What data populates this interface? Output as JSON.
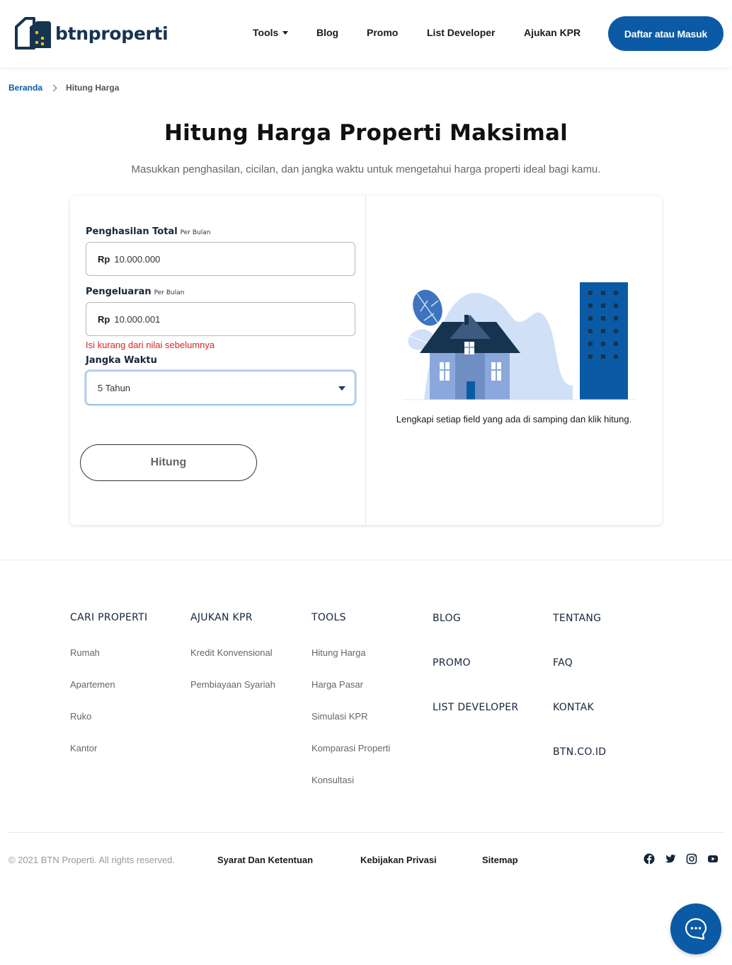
{
  "header": {
    "logo_text": "btnproperti",
    "nav": {
      "tools": "Tools",
      "blog": "Blog",
      "promo": "Promo",
      "list_developer": "List Developer",
      "ajukan_kpr": "Ajukan KPR"
    },
    "login_button": "Daftar atau Masuk"
  },
  "breadcrumb": {
    "home": "Beranda",
    "current": "Hitung Harga"
  },
  "page": {
    "title": "Hitung Harga Properti Maksimal",
    "subtitle": "Masukkan penghasilan, cicilan, dan jangka waktu untuk mengetahui harga properti ideal bagi kamu."
  },
  "form": {
    "income": {
      "label": "Penghasilan Total",
      "sublabel": "Per Bulan",
      "prefix": "Rp",
      "value": "10.000.000"
    },
    "expense": {
      "label": "Pengeluaran",
      "sublabel": "Per Bulan",
      "prefix": "Rp",
      "value": "10.000.001",
      "error": "Isi kurang dari nilai sebelumnya"
    },
    "term": {
      "label": "Jangka Waktu",
      "selected": "5 Tahun"
    },
    "submit": "Hitung"
  },
  "result": {
    "hint": "Lengkapi setiap field yang ada di samping dan klik hitung."
  },
  "footer": {
    "cari_properti": {
      "heading": "CARI PROPERTI",
      "links": [
        "Rumah",
        "Apartemen",
        "Ruko",
        "Kantor"
      ]
    },
    "ajukan_kpr": {
      "heading": "AJUKAN KPR",
      "links": [
        "Kredit Konvensional",
        "Pembiayaan Syariah"
      ]
    },
    "tools": {
      "heading": "TOOLS",
      "links": [
        "Hitung Harga",
        "Harga Pasar",
        "Simulasi KPR",
        "Komparasi Properti",
        "Konsultasi"
      ]
    },
    "col4": [
      "BLOG",
      "PROMO",
      "LIST DEVELOPER"
    ],
    "col5": [
      "TENTANG",
      "FAQ",
      "KONTAK",
      "BTN.CO.ID"
    ],
    "copyright": "© 2021 BTN Properti. All rights reserved.",
    "legal": {
      "terms": "Syarat Dan Ketentuan",
      "privacy": "Kebijakan Privasi",
      "sitemap": "Sitemap"
    },
    "social": [
      "facebook-icon",
      "twitter-icon",
      "instagram-icon",
      "youtube-icon"
    ]
  },
  "colors": {
    "brand": "#0b5aa5",
    "brand_dark": "#16344f",
    "error": "#e02424"
  }
}
